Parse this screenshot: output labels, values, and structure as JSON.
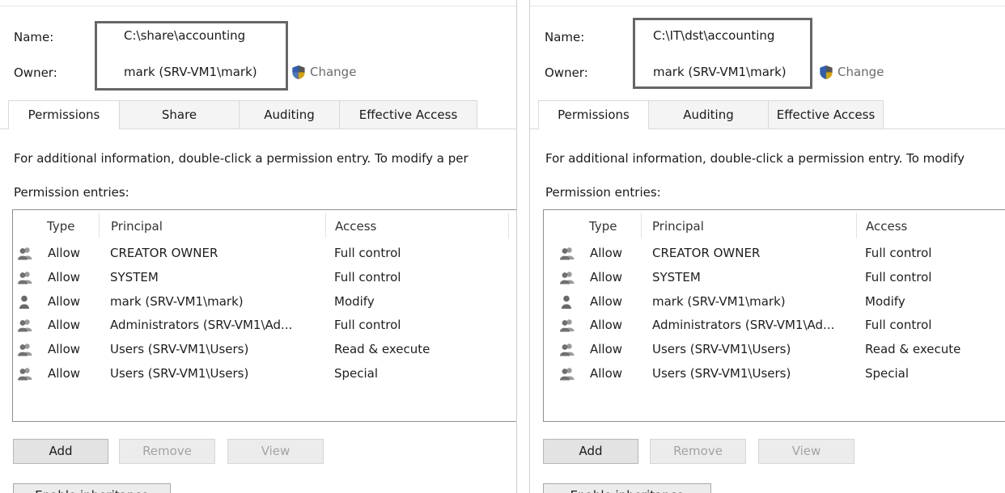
{
  "left": {
    "name_label": "Name:",
    "name_value": "C:\\share\\accounting",
    "owner_label": "Owner:",
    "owner_value": "mark (SRV-VM1\\mark)",
    "change_label": "Change",
    "tabs": [
      "Permissions",
      "Share",
      "Auditing",
      "Effective Access"
    ],
    "active_tab": "Permissions",
    "info_text": "For additional information, double-click a permission entry. To modify a per",
    "entries_label": "Permission entries:",
    "columns": {
      "type": "Type",
      "principal": "Principal",
      "access": "Access"
    },
    "rows": [
      {
        "type": "Allow",
        "principal": "CREATOR OWNER",
        "access": "Full control",
        "icon": "group-icon"
      },
      {
        "type": "Allow",
        "principal": "SYSTEM",
        "access": "Full control",
        "icon": "group-icon"
      },
      {
        "type": "Allow",
        "principal": "mark (SRV-VM1\\mark)",
        "access": "Modify",
        "icon": "user-icon"
      },
      {
        "type": "Allow",
        "principal": "Administrators (SRV-VM1\\Ad...",
        "access": "Full control",
        "icon": "group-icon"
      },
      {
        "type": "Allow",
        "principal": "Users (SRV-VM1\\Users)",
        "access": "Read & execute",
        "icon": "group-icon"
      },
      {
        "type": "Allow",
        "principal": "Users (SRV-VM1\\Users)",
        "access": "Special",
        "icon": "group-icon"
      }
    ],
    "buttons": {
      "add": "Add",
      "remove": "Remove",
      "view": "View",
      "inheritance": "Enable inheritance"
    }
  },
  "right": {
    "name_label": "Name:",
    "name_value": "C:\\IT\\dst\\accounting",
    "owner_label": "Owner:",
    "owner_value": "mark (SRV-VM1\\mark)",
    "change_label": "Change",
    "tabs": [
      "Permissions",
      "Auditing",
      "Effective Access"
    ],
    "active_tab": "Permissions",
    "info_text": "For additional information, double-click a permission entry. To modify",
    "entries_label": "Permission entries:",
    "columns": {
      "type": "Type",
      "principal": "Principal",
      "access": "Access"
    },
    "rows": [
      {
        "type": "Allow",
        "principal": "CREATOR OWNER",
        "access": "Full control",
        "icon": "group-icon"
      },
      {
        "type": "Allow",
        "principal": "SYSTEM",
        "access": "Full control",
        "icon": "group-icon"
      },
      {
        "type": "Allow",
        "principal": "mark (SRV-VM1\\mark)",
        "access": "Modify",
        "icon": "user-icon"
      },
      {
        "type": "Allow",
        "principal": "Administrators (SRV-VM1\\Ad...",
        "access": "Full control",
        "icon": "group-icon"
      },
      {
        "type": "Allow",
        "principal": "Users (SRV-VM1\\Users)",
        "access": "Read & execute",
        "icon": "group-icon"
      },
      {
        "type": "Allow",
        "principal": "Users (SRV-VM1\\Users)",
        "access": "Special",
        "icon": "group-icon"
      }
    ],
    "buttons": {
      "add": "Add",
      "remove": "Remove",
      "view": "View",
      "inheritance": "Enable inheritance"
    }
  },
  "colors": {
    "highlight_box": "#666666",
    "shield_blue": "#2f5fb0",
    "shield_gray": "#555555"
  }
}
